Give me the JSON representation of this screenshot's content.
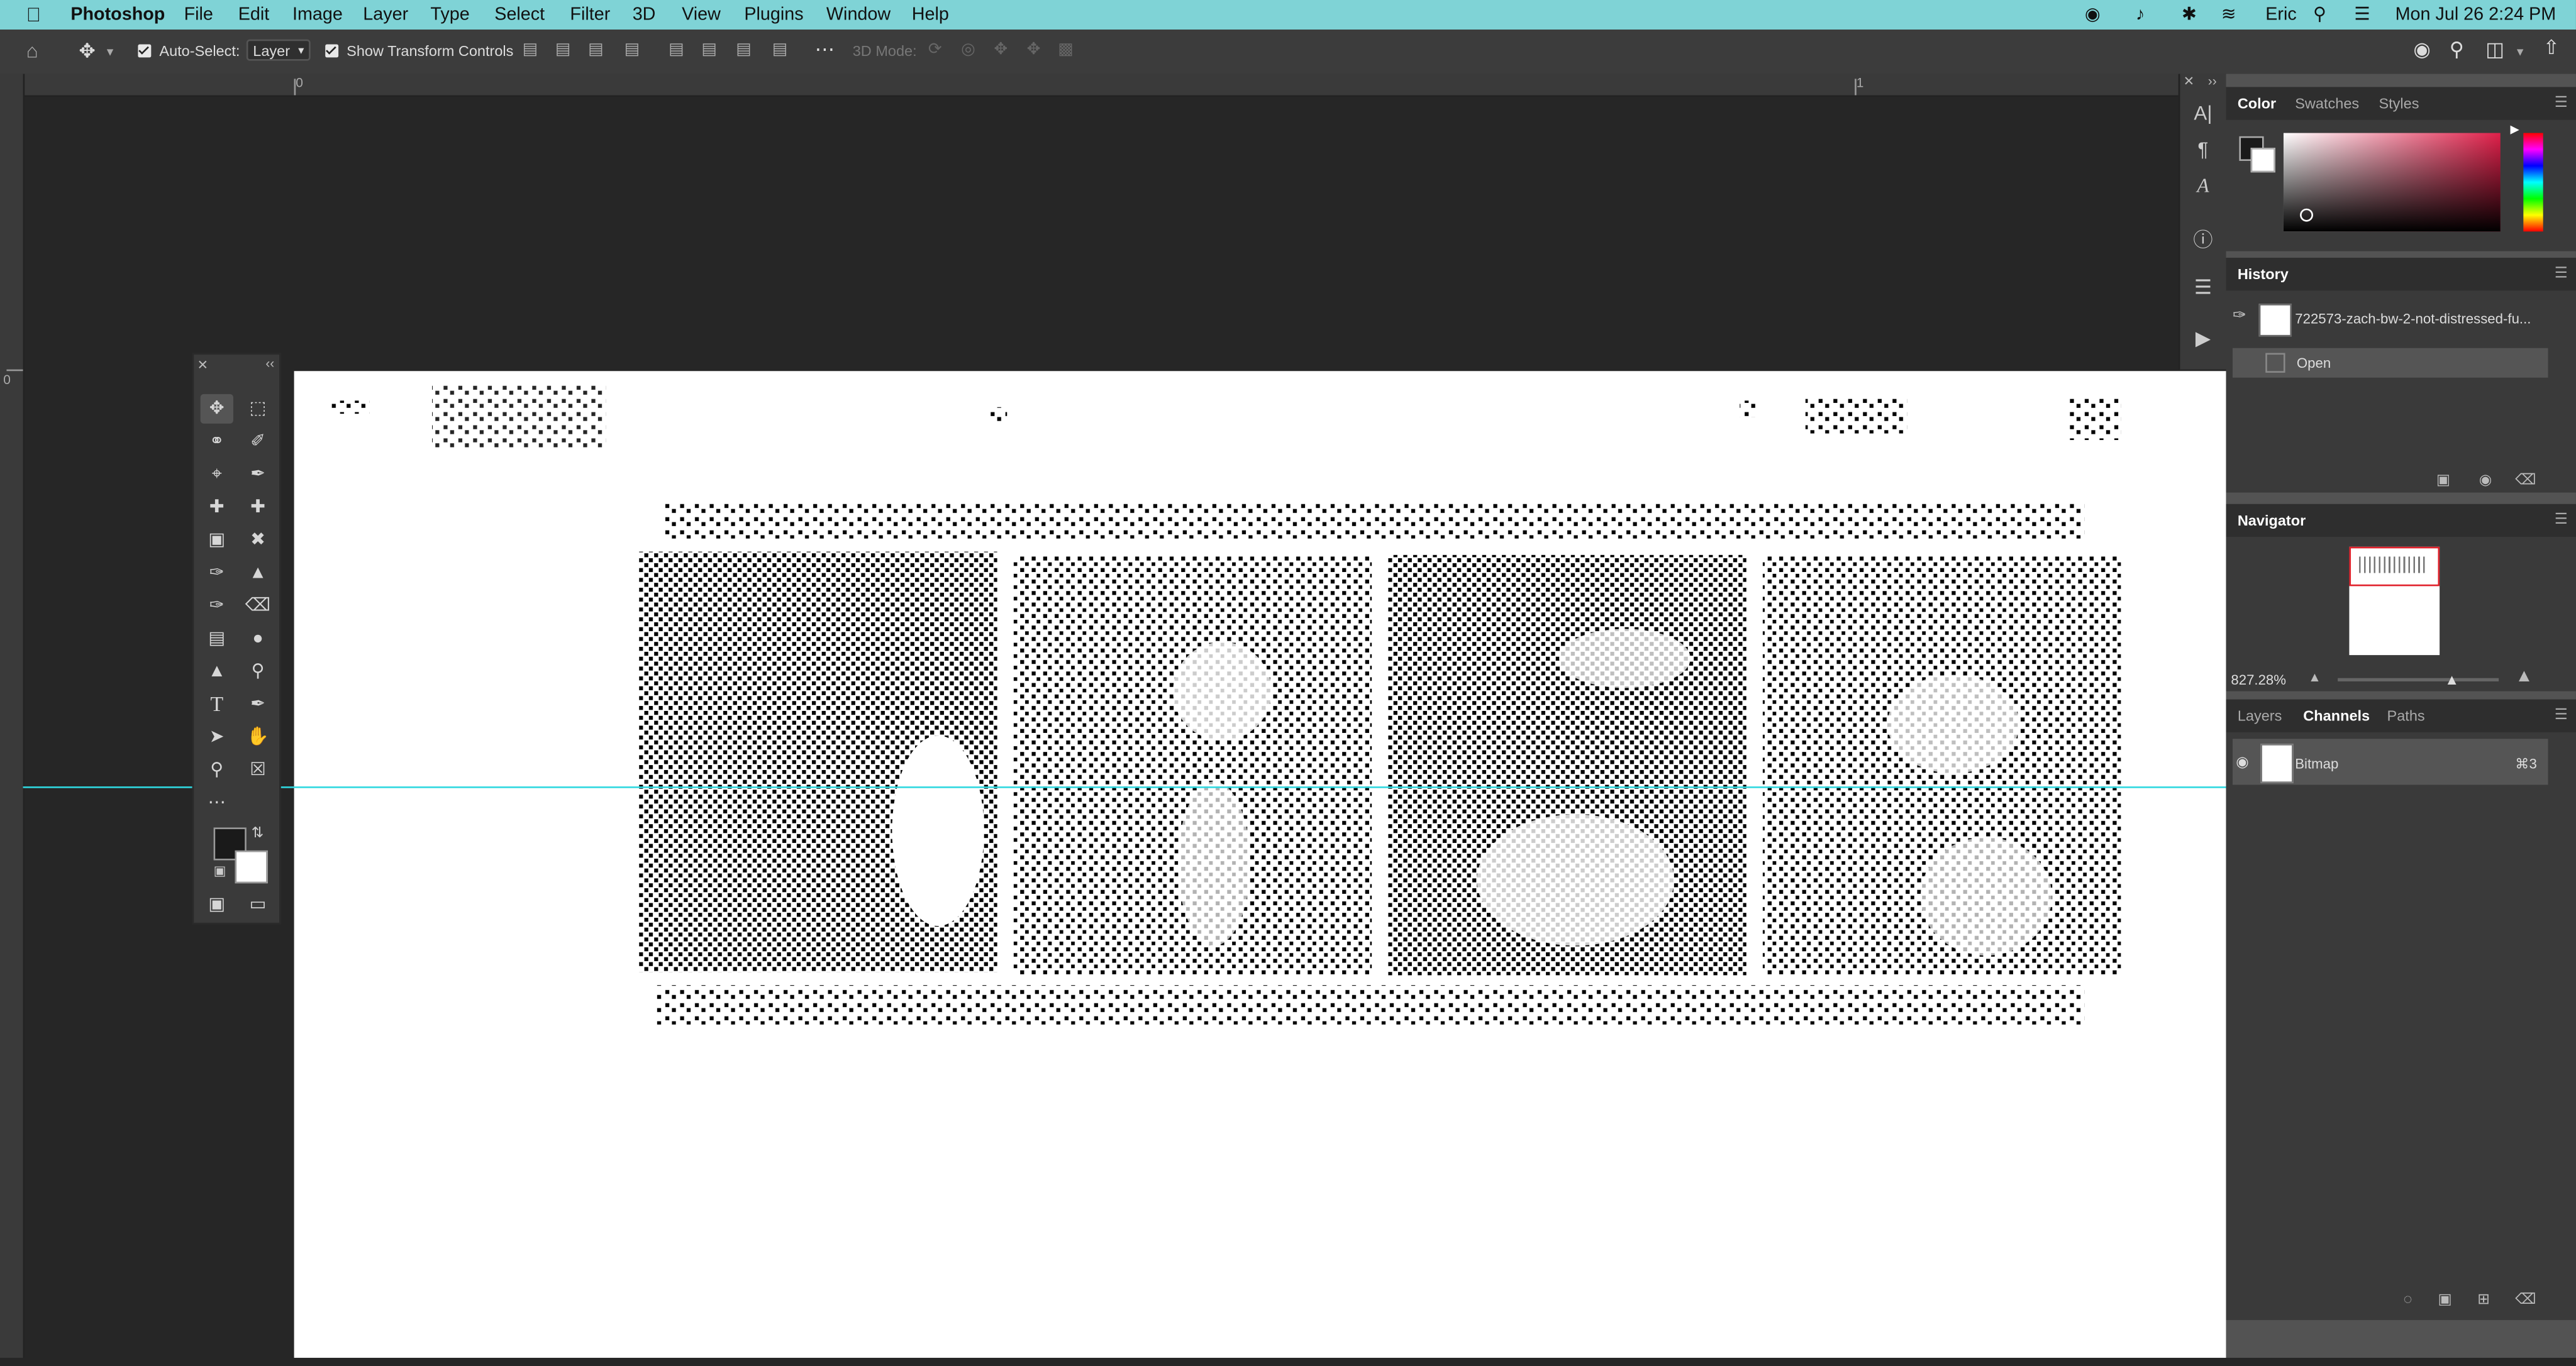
{
  "menubar": {
    "apple_icon": "apple-icon",
    "app_name": "Photoshop",
    "items": [
      "File",
      "Edit",
      "Image",
      "Layer",
      "Type",
      "Select",
      "Filter",
      "3D",
      "View",
      "Plugins",
      "Window",
      "Help"
    ],
    "status": {
      "user": "Eric",
      "datetime": "Mon Jul 26  2:24 PM"
    }
  },
  "options_bar": {
    "auto_select_label": "Auto-Select:",
    "auto_select_value": "Layer",
    "show_transform_label": "Show Transform Controls",
    "mode_3d_label": "3D Mode:"
  },
  "rulers": {
    "top_zero": "0",
    "top_one": "1",
    "left_zero": "0"
  },
  "panels": {
    "color": {
      "tabs": [
        "Color",
        "Swatches",
        "Styles"
      ]
    },
    "history": {
      "title": "History",
      "snapshot_name": "722573-zach-bw-2-not-distressed-fu...",
      "step": "Open"
    },
    "navigator": {
      "title": "Navigator",
      "zoom": "827.28%"
    },
    "layers": {
      "tabs": [
        "Layers",
        "Channels",
        "Paths"
      ],
      "channel_name": "Bitmap",
      "channel_shortcut": "⌘3"
    }
  },
  "colors": {
    "menubar": "#7fd3d6",
    "guide": "#2fd8e0",
    "panel_bg": "#3a3a3a"
  }
}
